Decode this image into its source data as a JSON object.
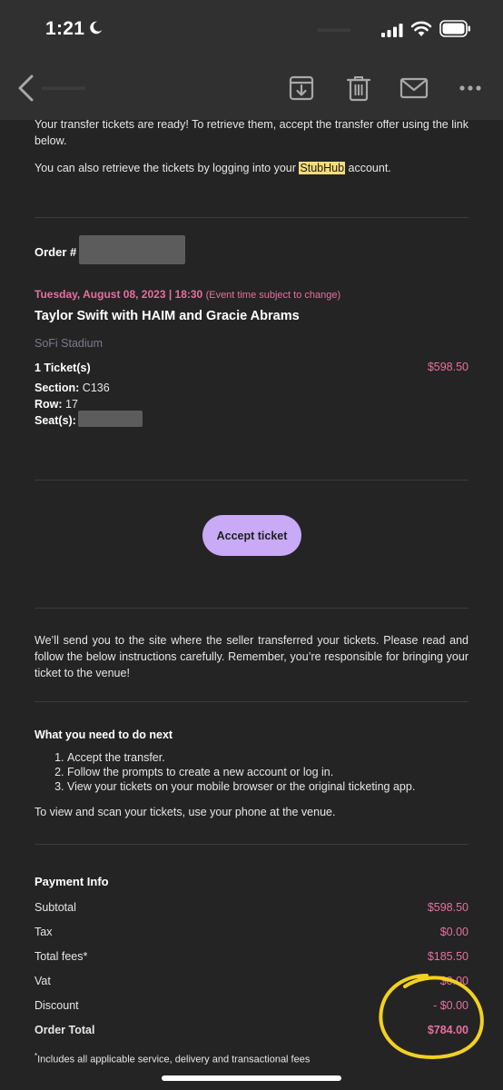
{
  "status_bar": {
    "time": "1:21"
  },
  "nav": {
    "back_icon": "chevron-left-icon",
    "actions": [
      "archive-icon",
      "trash-icon",
      "mail-icon",
      "more-icon"
    ]
  },
  "intro": {
    "line1": "Your transfer tickets are ready! To retrieve them, accept the transfer offer using the link below.",
    "line2_before": "You can also retrieve the tickets by logging into your ",
    "line2_brand": "StubHub",
    "line2_after": " account."
  },
  "order": {
    "label": "Order #",
    "event_datetime": "Tuesday, August 08, 2023 | 18:30",
    "event_note": "(Event time subject to change)",
    "event_name": "Taylor Swift with HAIM and Gracie Abrams",
    "venue": "SoFi Stadium",
    "tickets_label": "1 Ticket(s)",
    "tickets_price": "$598.50",
    "section_label": "Section:",
    "section_value": "C136",
    "row_label": "Row:",
    "row_value": "17",
    "seats_label": "Seat(s):"
  },
  "accept_button": "Accept ticket",
  "notice": "We’ll send you to the site where the seller transferred your tickets. Please read and follow the below instructions carefully. Remember, you’re responsible for bringing your ticket to the venue!",
  "next_steps": {
    "title": "What you need to do next",
    "items": [
      "Accept the transfer.",
      "Follow the prompts to create a new account or log in.",
      "View your tickets on your mobile browser or the original ticketing app."
    ],
    "footer": "To view and scan your tickets, use your phone at the venue."
  },
  "payment": {
    "title": "Payment Info",
    "rows": [
      {
        "label": "Subtotal",
        "value": "$598.50"
      },
      {
        "label": "Tax",
        "value": "$0.00"
      },
      {
        "label": "Total fees*",
        "value": "$185.50"
      },
      {
        "label": "Vat",
        "value": "$0.00"
      },
      {
        "label": "Discount",
        "value": "- $0.00"
      }
    ],
    "total_label": "Order Total",
    "total_value": "$784.00",
    "footnote_mark": "*",
    "footnote": "Includes all applicable service, delivery and transactional fees"
  },
  "colors": {
    "background": "#242424",
    "header": "#303030",
    "accent_pink": "#e5709f",
    "accent_purple": "#c9aaf6",
    "highlight": "#f4dc7c",
    "annotation": "#f2d11f"
  }
}
